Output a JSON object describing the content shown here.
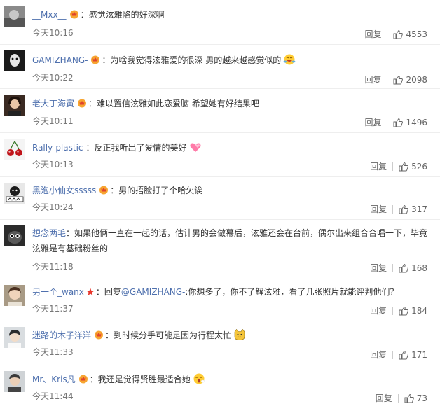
{
  "comments": [
    {
      "user": "__Mxx__",
      "colon": "：",
      "text": "感觉泫雅陷的好深啊",
      "time": "今天10:16",
      "reply": "回复",
      "likes": "4553",
      "icon": "vip-crown-icon"
    },
    {
      "user": "GAMIZHANG-",
      "colon": "：",
      "text": "为啥我觉得泫雅爱的很深 男的越来越感觉似的",
      "time": "今天10:22",
      "reply": "回复",
      "likes": "2098",
      "icon": "vip-crown-icon",
      "emoji": "laughing-face-emoji"
    },
    {
      "user": "老大丁海寅",
      "colon": "：",
      "text": "难以置信泫雅如此恋爱脑 希望她有好结果吧",
      "time": "今天10:11",
      "reply": "回复",
      "likes": "1496",
      "icon": "vip-crown-icon"
    },
    {
      "user": "Rally-plastic",
      "colon": "：",
      "text": "反正我听出了爱情的美好",
      "time": "今天10:13",
      "reply": "回复",
      "likes": "526",
      "emoji": "pink-hearts-emoji"
    },
    {
      "user": "黑泡小仙女sssss",
      "colon": "：",
      "text": "男的捂脸打了个哈欠诶",
      "time": "今天10:24",
      "reply": "回复",
      "likes": "317",
      "icon": "vip-crown-icon"
    },
    {
      "user": "想念两毛",
      "colon": "：",
      "text": "如果他俩一直在一起的话，估计男的会做幕后，泫雅还会在台前，偶尔出来组合合唱一下，毕竟泫雅是有基础粉丝的",
      "time": "今天11:18",
      "reply": "回复",
      "likes": "168"
    },
    {
      "user": "另一个_wanx",
      "colon": "：",
      "text_prefix": "回复",
      "mention": "@GAMIZHANG-",
      "text": ":你想多了，你不了解泫雅，看了几张照片就能评判他们？",
      "time": "今天11:37",
      "reply": "回复",
      "likes": "184",
      "icon": "red-star-icon"
    },
    {
      "user": "迷路的木子洋洋",
      "colon": "：",
      "text": "到时候分手可能是因为行程太忙",
      "time": "今天11:33",
      "reply": "回复",
      "likes": "171",
      "icon": "vip-crown-icon",
      "emoji": "cat-face-emoji"
    },
    {
      "user": "Mr、Kris凡",
      "colon": "：",
      "text": "我还是觉得贤胜最适合她",
      "time": "今天11:44",
      "reply": "回复",
      "likes": "73",
      "icon": "vip-crown-icon",
      "emoji": "yawning-face-emoji"
    }
  ],
  "colors": {
    "link": "#4d6fad",
    "text": "#333333",
    "meta": "#777777",
    "vip": "#f7a531"
  }
}
